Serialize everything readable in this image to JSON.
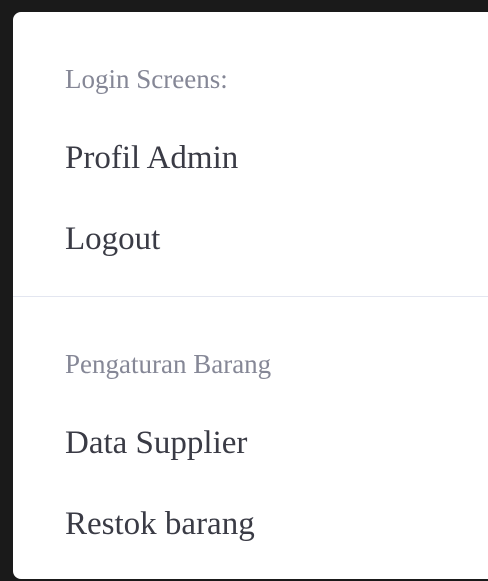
{
  "menu": {
    "section1_header": "Login Screens:",
    "section1_items": [
      "Profil Admin",
      "Logout"
    ],
    "section2_header": "Pengaturan Barang",
    "section2_items": [
      "Data Supplier",
      "Restok barang"
    ]
  }
}
